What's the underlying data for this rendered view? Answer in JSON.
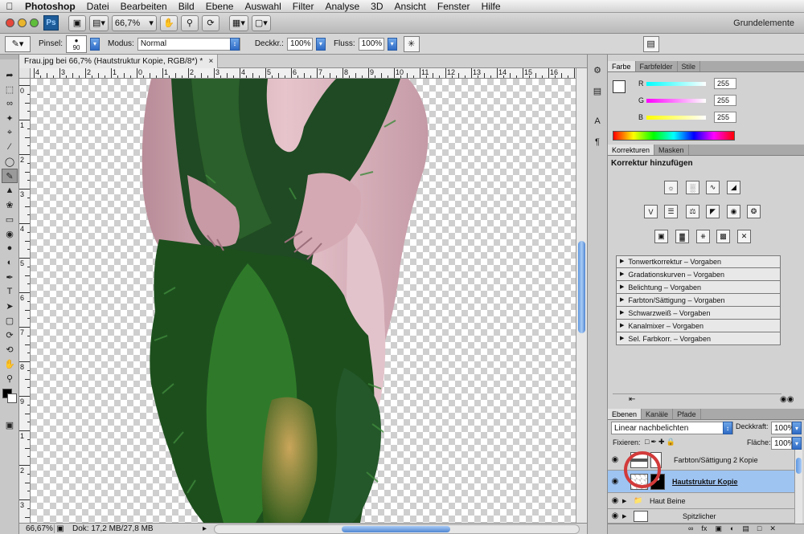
{
  "menu": {
    "app": "Photoshop",
    "items": [
      "Datei",
      "Bearbeiten",
      "Bild",
      "Ebene",
      "Auswahl",
      "Filter",
      "Analyse",
      "3D",
      "Ansicht",
      "Fenster",
      "Hilfe"
    ]
  },
  "appbar": {
    "logo": "Ps",
    "zoom": "66,7%",
    "workspace": "Grundelemente"
  },
  "options": {
    "brush_label": "Pinsel:",
    "brush_size": "90",
    "mode_label": "Modus:",
    "mode_value": "Normal",
    "opacity_label": "Deckkr.:",
    "opacity_value": "100%",
    "flow_label": "Fluss:",
    "flow_value": "100%"
  },
  "document": {
    "tab_title": "Frau.jpg bei 66,7% (Hautstruktur Kopie, RGB/8*) *",
    "close": "×"
  },
  "rulers": {
    "h_labels": [
      "4",
      "3",
      "2",
      "1",
      "0",
      "1",
      "2",
      "3",
      "4",
      "5",
      "6",
      "7",
      "8",
      "9",
      "10",
      "11",
      "12",
      "13",
      "14",
      "15",
      "16",
      "17"
    ],
    "v_labels": [
      "0",
      "1",
      "2",
      "3",
      "4",
      "5",
      "6",
      "7",
      "8",
      "9",
      "1",
      "2",
      "3"
    ]
  },
  "status": {
    "zoom": "66,67%",
    "doc": "Dok: 17,2 MB/27,8 MB"
  },
  "color_panel": {
    "tabs": [
      "Farbe",
      "Farbfelder",
      "Stile"
    ],
    "r_label": "R",
    "r_value": "255",
    "g_label": "G",
    "g_value": "255",
    "b_label": "B",
    "b_value": "255"
  },
  "adjust_panel": {
    "tabs": [
      "Korrekturen",
      "Masken"
    ],
    "title": "Korrektur hinzufügen",
    "presets": [
      "Tonwertkorrektur – Vorgaben",
      "Gradationskurven – Vorgaben",
      "Belichtung – Vorgaben",
      "Farbton/Sättigung – Vorgaben",
      "Schwarzweiß – Vorgaben",
      "Kanalmixer – Vorgaben",
      "Sel. Farbkorr. – Vorgaben"
    ]
  },
  "layers_panel": {
    "tabs": [
      "Ebenen",
      "Kanäle",
      "Pfade"
    ],
    "blend_mode": "Linear nachbelichten",
    "opacity_label": "Deckkraft:",
    "opacity_value": "100%",
    "lock_label": "Fixieren:",
    "fill_label": "Fläche:",
    "fill_value": "100%",
    "layers": [
      {
        "name": "Farbton/Sättigung 2 Kopie"
      },
      {
        "name": "Hautstruktur Kopie"
      },
      {
        "name": "Haut Beine"
      },
      {
        "name": "Spitzlicher"
      }
    ]
  },
  "colors": {
    "accent": "#9ec4f2",
    "highlight_ring": "#d23a3a",
    "foliage": "#1f5a1f"
  }
}
